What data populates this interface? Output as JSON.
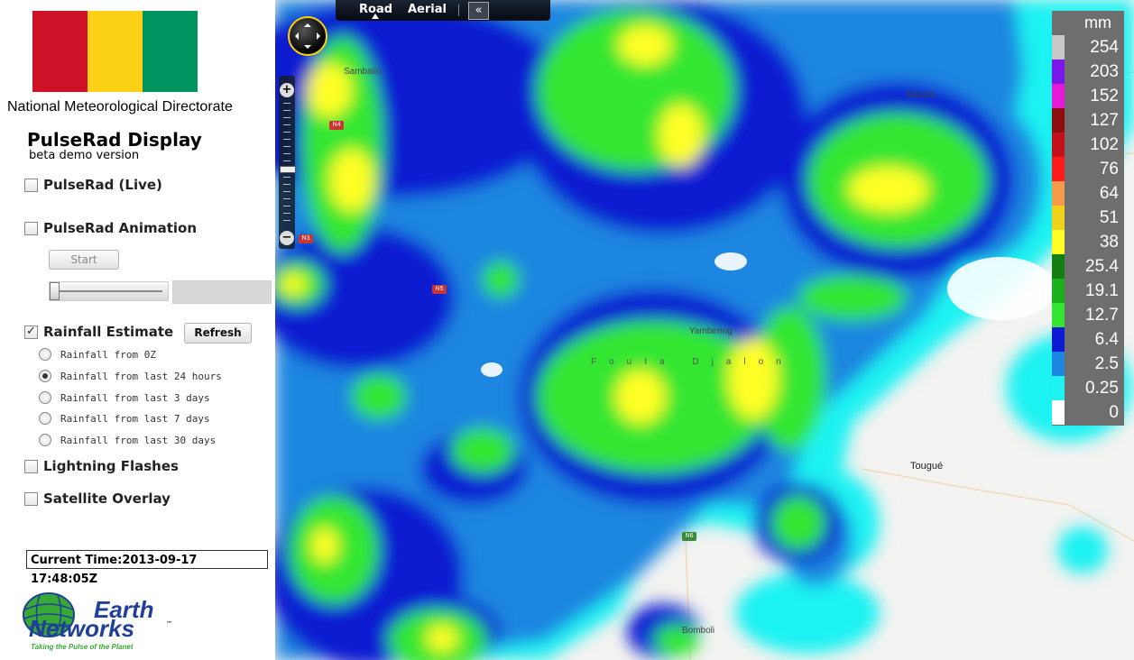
{
  "header": {
    "organization": "National Meteorological Directorate",
    "app_title": "PulseRad Display",
    "app_subtitle": "beta demo version",
    "flag_colors": [
      "#ce1126",
      "#fcd116",
      "#009460"
    ]
  },
  "controls": {
    "pulserad_live": {
      "label": "PulseRad (Live)",
      "checked": false
    },
    "pulserad_animation": {
      "label": "PulseRad Animation",
      "checked": false
    },
    "start_button": "Start",
    "rainfall_estimate": {
      "label": "Rainfall Estimate",
      "checked": true
    },
    "refresh_button": "Refresh",
    "rainfall_options": [
      {
        "label": "Rainfall from 0Z",
        "selected": false
      },
      {
        "label": "Rainfall from last 24 hours",
        "selected": true
      },
      {
        "label": "Rainfall from last 3 days",
        "selected": false
      },
      {
        "label": "Rainfall from last 7 days",
        "selected": false
      },
      {
        "label": "Rainfall from last 30 days",
        "selected": false
      }
    ],
    "lightning_flashes": {
      "label": "Lightning Flashes",
      "checked": false
    },
    "satellite_overlay": {
      "label": "Satellite Overlay",
      "checked": false
    }
  },
  "current_time": "Current Time:2013-09-17 17:48:05Z",
  "brand": {
    "name_line1": "Earth",
    "name_line2": "Networks",
    "tagline": "Taking the Pulse of the Planet",
    "trademark": "™",
    "color": "#1f3f9a",
    "tagline_color": "#39a935"
  },
  "map": {
    "view_tabs": {
      "road": "Road",
      "aerial": "Aerial",
      "collapse": "«"
    },
    "zoom_in": "+",
    "zoom_out": "−",
    "towns": [
      "Sambailo",
      "Missira",
      "Yambering",
      "Tougué",
      "Bomboli"
    ],
    "region_label": "Fouta Djalon",
    "road_shields": [
      "N4",
      "N5",
      "N3",
      "N6"
    ]
  },
  "legend": {
    "title": "mm",
    "items": [
      {
        "label": "254",
        "color": "#c8c8c8"
      },
      {
        "label": "203",
        "color": "#7b16e8"
      },
      {
        "label": "152",
        "color": "#e619d8"
      },
      {
        "label": "127",
        "color": "#8b0d0d"
      },
      {
        "label": "102",
        "color": "#c4101b"
      },
      {
        "label": "76",
        "color": "#ff1a1a"
      },
      {
        "label": "64",
        "color": "#f49a4b"
      },
      {
        "label": "51",
        "color": "#f0d21a"
      },
      {
        "label": "38",
        "color": "#ffff26"
      },
      {
        "label": "25.4",
        "color": "#137f13"
      },
      {
        "label": "19.1",
        "color": "#1cb11c"
      },
      {
        "label": "12.7",
        "color": "#33e633"
      },
      {
        "label": "6.4",
        "color": "#0d1ad1"
      },
      {
        "label": "2.5",
        "color": "#1f86e0"
      },
      {
        "label": "0.25",
        "color": "#1ff2f2"
      },
      {
        "label": "0",
        "color": "#ffffff"
      }
    ]
  }
}
